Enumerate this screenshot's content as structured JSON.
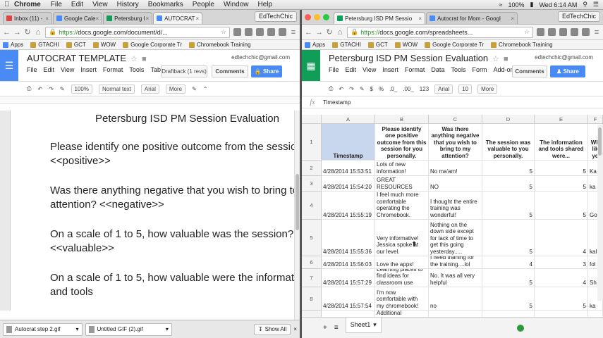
{
  "menubar": {
    "app": "Chrome",
    "items": [
      "File",
      "Edit",
      "View",
      "History",
      "Bookmarks",
      "People",
      "Window",
      "Help"
    ],
    "battery": "100%",
    "clock": "Wed 6:14 AM"
  },
  "left": {
    "tabs": [
      "Inbox (11) -",
      "Google Cale",
      "Petersburg I",
      "AUTOCRAT"
    ],
    "profile": "EdTechChic",
    "url_scheme": "https://",
    "url_rest": "docs.google.com/document/d/...",
    "bookmarks": [
      "Apps",
      "GTACHI",
      "GCT",
      "WOW",
      "Google Corporate Tr",
      "Chromebook Training"
    ],
    "doc_title": "AUTOCRAT TEMPLATE",
    "email": "edtechchic@gmail.com",
    "menu": [
      "File",
      "Edit",
      "View",
      "Insert",
      "Format",
      "Tools",
      "Table"
    ],
    "draftback": "Draftback (1 revs)",
    "comments": "Comments",
    "share": "Share",
    "fmt": {
      "zoom": "100%",
      "style": "Normal text",
      "font": "Arial",
      "more": "More"
    },
    "body": {
      "title": "Petersburg ISD PM Session Evaluation",
      "p1a": "Please identify one positive outcome from the session",
      "p1b": "<<positive>>",
      "p2a": "Was there anything negative that you wish to bring to",
      "p2b": "attention? <<negative>>",
      "p3a": "On a scale of 1 to 5, how valuable was the session?",
      "p3b": "<<valuable>>",
      "p4a": "On a scale of 1 to 5, how valuable were the informati",
      "p4b": "and tools"
    },
    "downloads": [
      "Autocrat step 2.gif",
      "Untitled GIF (2).gif"
    ],
    "show_all": "Show All"
  },
  "right": {
    "tabs": [
      "Petersburg ISD PM Sessio",
      "Autocrat for Mom - Googl"
    ],
    "profile": "EdTechChic",
    "url_scheme": "https://",
    "url_rest": "docs.google.com/spreadsheets...",
    "bookmarks": [
      "Apps",
      "GTACHI",
      "GCT",
      "WOW",
      "Google Corporate Tr",
      "Chromebook Training"
    ],
    "sheet_title": "Petersburg ISD PM Session Evaluation",
    "email": "edtechchic@gmail.com",
    "menu": [
      "File",
      "Edit",
      "View",
      "Insert",
      "Format",
      "Data",
      "Tools",
      "Form",
      "Add-ons"
    ],
    "comments": "Comments",
    "share": "Share",
    "fmt": {
      "dollar": "$",
      "pct": "%",
      "dec0": ".0_",
      "dec00": ".00_",
      "num": "123",
      "font": "Arial",
      "size": "10",
      "more": "More"
    },
    "formula": "Timestamp",
    "columns": [
      "A",
      "B",
      "C",
      "D",
      "E",
      "F"
    ],
    "header_row": [
      "Timestamp",
      "Please identify one positive outcome from this session for you personally.",
      "Was there anything negative that you wish to bring to my attention?",
      "The session was valuable to you personally.",
      "The information and tools shared were...",
      "Wh lik yo"
    ],
    "rows": [
      {
        "n": "2",
        "a": "4/28/2014 15:53:51",
        "b": "Lots of new information!",
        "c": "No ma'am!",
        "d": "5",
        "e": "5",
        "f": "Ka"
      },
      {
        "n": "3",
        "a": "4/28/2014 15:54:20",
        "b": "GREAT RESOURCES",
        "c": "NO",
        "d": "5",
        "e": "5",
        "f": "ka"
      },
      {
        "n": "4",
        "a": "4/28/2014 15:55:19",
        "b": "I feel much more comfortable operating the Chromebook.",
        "c": "I thought the entire training was wonderful!",
        "d": "5",
        "e": "5",
        "f": "Go"
      },
      {
        "n": "5",
        "a": "4/28/2014 15:55:36",
        "b": "Very informative! Jessica spoke at our level.",
        "c": "Nothing on the down side except for lack of time to get this going yesterday.....",
        "d": "5",
        "e": "4",
        "f": "kal"
      },
      {
        "n": "6",
        "a": "4/28/2014 15:56:03",
        "b": "Love the apps!",
        "c": "I need training for the training....lol",
        "d": "4",
        "e": "3",
        "f": "fol"
      },
      {
        "n": "7",
        "a": "4/28/2014 15:57:29",
        "b": "Learning places to find ideas for classroom use",
        "c": "No.  It was all very helpful",
        "d": "5",
        "e": "4",
        "f": "Sh"
      },
      {
        "n": "8",
        "a": "4/28/2014 15:57:54",
        "b": "I'm now comfortable with my chromebook!",
        "c": "no",
        "d": "5",
        "e": "5",
        "f": "ka"
      },
      {
        "n": "",
        "a": "",
        "b": "Additional Resources",
        "c": "",
        "d": "",
        "e": "",
        "f": ""
      }
    ],
    "sheet_tab": "Sheet1"
  }
}
